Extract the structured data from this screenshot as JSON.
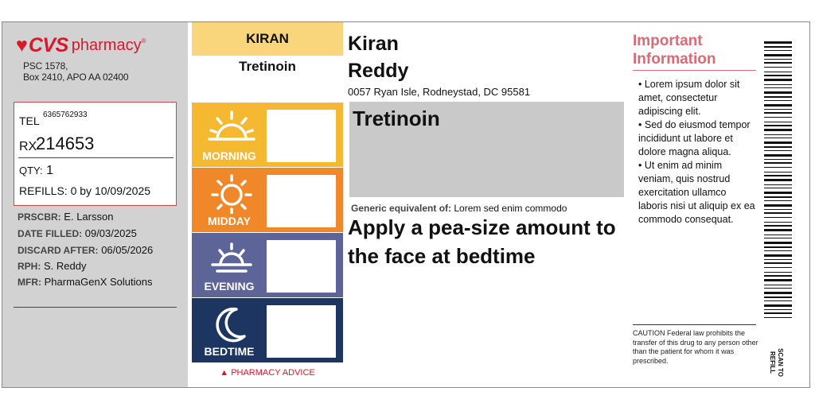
{
  "brand": {
    "heart": "♥",
    "name": "CVS",
    "pharmacy": "pharmacy",
    "tm": "®"
  },
  "store_address": [
    "PSC 1578,",
    "Box 2410, APO AA 02400"
  ],
  "tel_label": "TEL",
  "tel": "6365762933",
  "rx_label": "RX",
  "rx_number": "214653",
  "qty_label": "QTY:",
  "qty": "1",
  "refills_label": "REFILLS:",
  "refills": "0 by 10/09/2025",
  "details": [
    {
      "label": "PRSCBR:",
      "value": "E. Larsson"
    },
    {
      "label": "DATE FILLED:",
      "value": "09/03/2025"
    },
    {
      "label": "DISCARD AFTER:",
      "value": "06/05/2026"
    },
    {
      "label": "RPH:",
      "value": "S. Reddy"
    },
    {
      "label": "MFR:",
      "value": "PharmaGenX Solutions"
    }
  ],
  "schedule_name": "KIRAN",
  "schedule_drug": "Tretinoin",
  "schedule": [
    {
      "label": "MORNING",
      "color": "#f4b931",
      "icon": "sunrise-icon"
    },
    {
      "label": "MIDDAY",
      "color": "#f0882a",
      "icon": "sun-icon"
    },
    {
      "label": "EVENING",
      "color": "#5d6498",
      "icon": "sunset-icon"
    },
    {
      "label": "BEDTIME",
      "color": "#1d3661",
      "icon": "moon-icon"
    }
  ],
  "advice": "▲ PHARMACY ADVICE",
  "patient": {
    "first": "Kiran",
    "last": "Reddy",
    "address": "0057 Ryan Isle, Rodneystad, DC 95581"
  },
  "drug": "Tretinoin",
  "generic_label": "Generic equivalent of:",
  "generic_value": "Lorem sed enim commodo",
  "directions": "Apply a pea-size amount to the face at bedtime",
  "important": {
    "title": "Important Information",
    "items": [
      "Lorem ipsum dolor sit amet, consectetur adipiscing elit.",
      "Sed do eiusmod tempor incididunt ut labore et dolore magna aliqua.",
      "Ut enim ad minim veniam, quis nostrud exercitation ullamco laboris nisi ut aliquip ex ea commodo consequat."
    ]
  },
  "caution": "CAUTION Federal law prohibits the transfer of this drug to any person other than the patient for whom it was prescribed.",
  "scan": [
    "SCAN TO",
    "REFILL"
  ],
  "colors": {
    "brand": "#d7192c",
    "important": "#d96b74",
    "left_panel": "#d2d2d2",
    "name_band": "#f9d57c"
  }
}
